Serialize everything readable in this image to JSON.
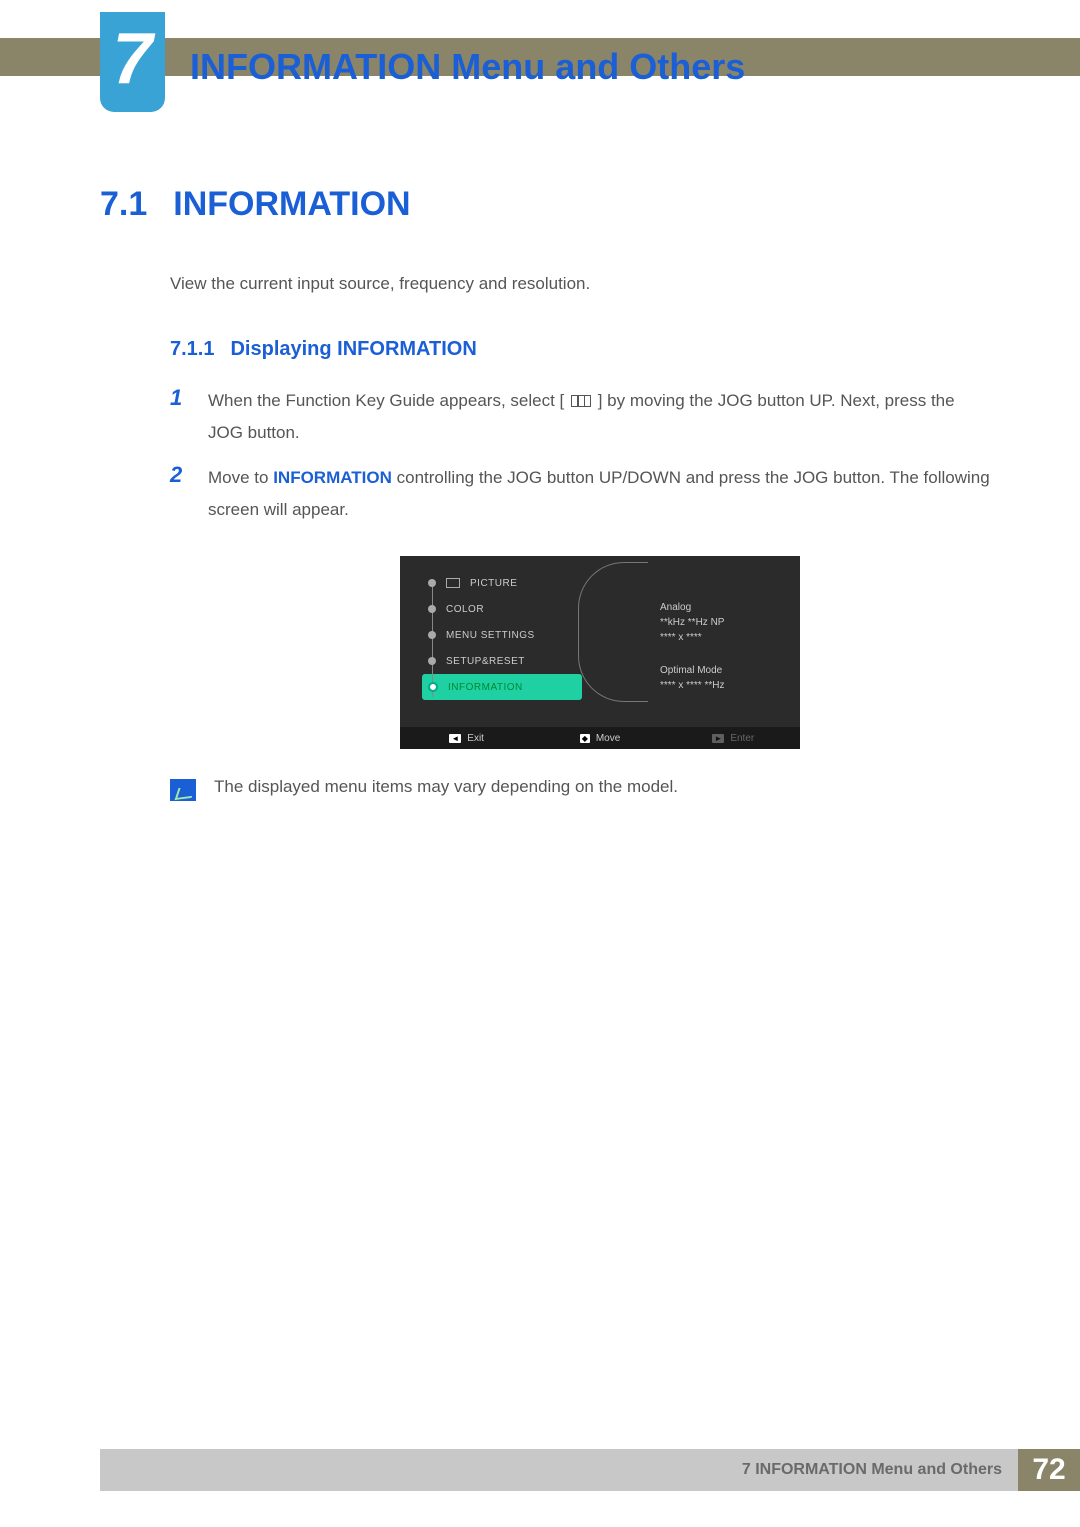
{
  "chapter": {
    "number": "7",
    "title": "INFORMATION Menu and Others"
  },
  "section": {
    "number": "7.1",
    "title": "INFORMATION",
    "intro": "View the current input source, frequency and resolution."
  },
  "subsection": {
    "number": "7.1.1",
    "title": "Displaying INFORMATION"
  },
  "steps": {
    "s1": {
      "num": "1",
      "text_a": "When the Function Key Guide appears, select [",
      "text_b": "] by moving the JOG button UP. Next, press the JOG button."
    },
    "s2": {
      "num": "2",
      "text_a": "Move to ",
      "keyword": "INFORMATION",
      "text_b": " controlling the JOG button UP/DOWN and press the JOG button. The following screen will appear."
    }
  },
  "osd": {
    "menu": {
      "picture": "PICTURE",
      "color": "COLOR",
      "menu_settings": "MENU SETTINGS",
      "setup_reset": "SETUP&RESET",
      "information": "INFORMATION"
    },
    "info": {
      "l1": "Analog",
      "l2": "**kHz **Hz NP",
      "l3": "**** x ****",
      "l4": "Optimal Mode",
      "l5": "**** x **** **Hz"
    },
    "footer": {
      "exit": "Exit",
      "move": "Move",
      "enter": "Enter"
    }
  },
  "note": "The displayed menu items may vary depending on the model.",
  "footer": {
    "label": "7 INFORMATION Menu and Others",
    "page": "72"
  }
}
